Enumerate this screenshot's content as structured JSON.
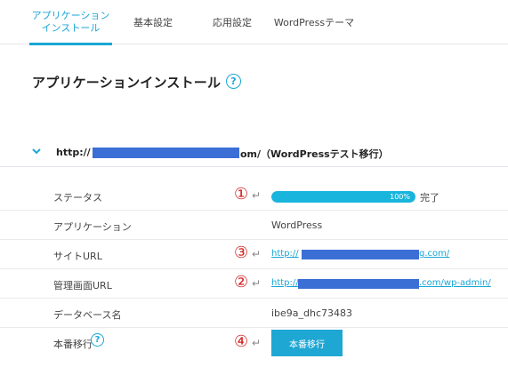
{
  "tabs": [
    {
      "line1": "アプリケーション",
      "line2": "インストール",
      "active": true
    },
    {
      "line1": "基本設定"
    },
    {
      "line1": "応用設定"
    },
    {
      "line1": "WordPressテーマ"
    }
  ],
  "page": {
    "title": "アプリケーションインストール",
    "help": "?"
  },
  "section": {
    "url_prefix": "http://",
    "url_suffix": "om/（WordPressテスト移行）"
  },
  "rows": {
    "status": {
      "label": "ステータス",
      "marker": "①",
      "progress_percent": 100,
      "progress_text": "100%",
      "done_text": "完了"
    },
    "app": {
      "label": "アプリケーション",
      "value": "WordPress"
    },
    "site_url": {
      "label": "サイトURL",
      "marker": "③",
      "url_prefix": "http://",
      "url_suffix": "g.com/"
    },
    "admin_url": {
      "label": "管理画面URL",
      "marker": "②",
      "url_prefix": "http://",
      "url_suffix": ".com/wp-admin/"
    },
    "db": {
      "label": "データベース名",
      "value": "ibe9a_dhc73483"
    },
    "production": {
      "label": "本番移行",
      "help": "?",
      "marker": "④",
      "button_label": "本番移行"
    }
  },
  "enter_symbol": "↵",
  "colors": {
    "accent": "#19a6d6",
    "redaction": "#3b6fd6",
    "marker": "#d11f1f"
  }
}
